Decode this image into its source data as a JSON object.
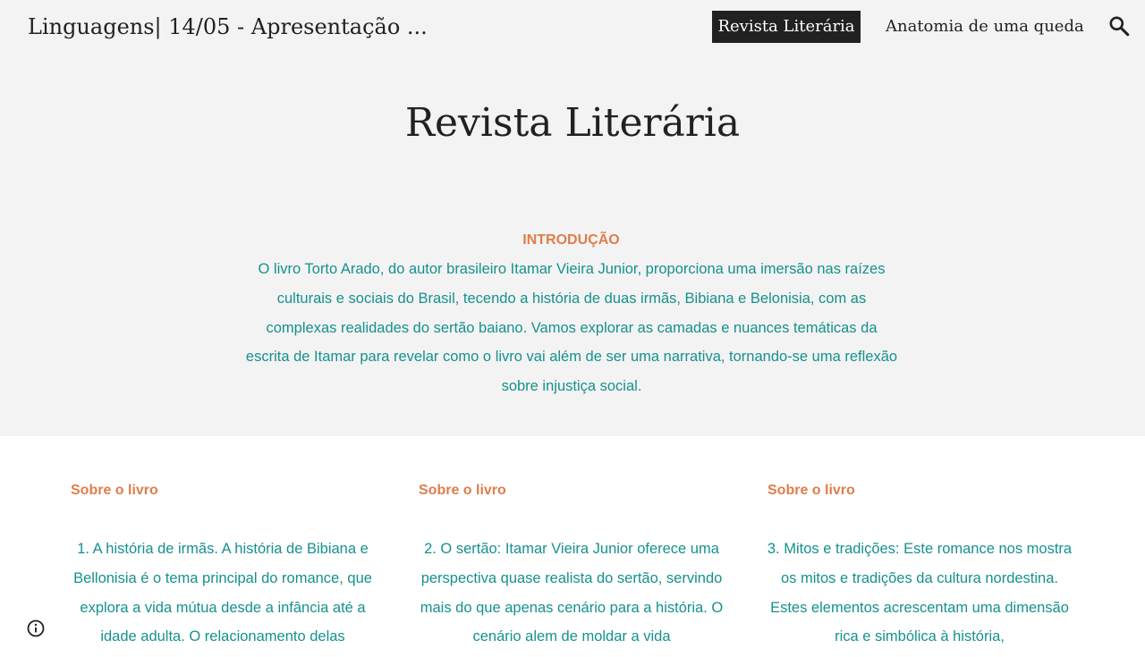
{
  "header": {
    "site_title": "Linguagens| 14/05 - Apresentação ...",
    "nav": [
      {
        "label": "Revista Literária",
        "active": true
      },
      {
        "label": "Anatomia de uma queda",
        "active": false
      }
    ],
    "search_icon": "search-icon"
  },
  "hero": {
    "title": "Revista Literária"
  },
  "intro": {
    "heading": "INTRODUÇÃO",
    "body": "O livro Torto Arado, do autor brasileiro Itamar Vieira Junior, proporciona uma imersão nas raízes culturais e sociais do Brasil, tecendo a história de duas irmãs, Bibiana e Belonisia, com as complexas realidades do sertão baiano. Vamos explorar as camadas e nuances temáticas da escrita de Itamar para revelar como o livro vai além de ser uma narrativa, tornando-se uma reflexão sobre injustiça social."
  },
  "columns": [
    {
      "heading": "Sobre o livro",
      "body": "1. A história de irmãs. A história de Bibiana e Bellonisia é o tema principal do romance, que explora a vida mútua desde a infância até a idade adulta. O relacionamento delas"
    },
    {
      "heading": "Sobre o livro",
      "body": "2. O sertão: Itamar Vieira Junior oferece uma perspectiva quase realista do sertão, servindo mais do que apenas cenário para a história. O cenário alem de moldar a vida"
    },
    {
      "heading": "Sobre o livro",
      "body": "3. Mitos e tradições: Este romance nos mostra os mitos e tradições da cultura nordestina. Estes elementos acrescentam uma dimensão rica e simbólica à história,"
    }
  ],
  "colors": {
    "accent_heading": "#e07d4c",
    "body_text": "#16918d",
    "nav_active_bg": "#212121",
    "top_bg": "#f3f3f3"
  },
  "footer": {
    "info_icon": "info-icon"
  }
}
